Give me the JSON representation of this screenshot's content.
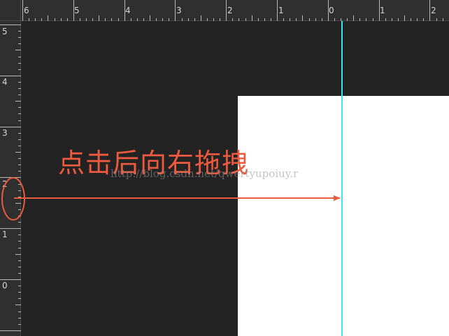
{
  "ruler_top": {
    "labels": [
      "6",
      "5",
      "4",
      "3",
      "2",
      "1",
      "0",
      "1",
      "2"
    ]
  },
  "ruler_left": {
    "labels": [
      "5",
      "4",
      "3",
      "2",
      "1",
      "0"
    ]
  },
  "guide": {
    "color": "#3fe3f3"
  },
  "annotation": {
    "text": "点击后向右拖拽",
    "color": "#ec5a3f"
  },
  "watermark": {
    "text": "http://blog.csdn.net/qwertyupoiuy.r"
  }
}
